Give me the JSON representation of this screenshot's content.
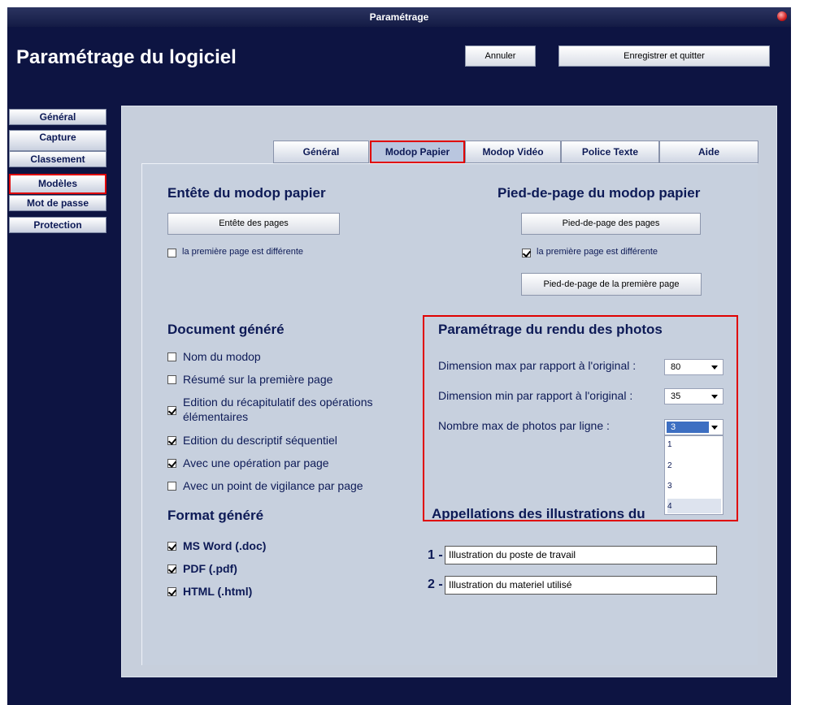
{
  "window": {
    "title": "Paramétrage"
  },
  "header": {
    "title": "Paramétrage du logiciel",
    "cancel_label": "Annuler",
    "save_label": "Enregistrer et quitter"
  },
  "sidebar": {
    "items": [
      {
        "label": "Général"
      },
      {
        "label": "Capture"
      },
      {
        "label": "Classement"
      },
      {
        "label": "Modèles"
      },
      {
        "label": "Mot de passe"
      },
      {
        "label": "Protection"
      }
    ],
    "selected": "Modèles"
  },
  "tabs": [
    {
      "label": "Général"
    },
    {
      "label": "Modop Papier"
    },
    {
      "label": "Modop Vidéo"
    },
    {
      "label": "Police Texte"
    },
    {
      "label": "Aide"
    }
  ],
  "selected_tab": "Modop Papier",
  "entete": {
    "heading": "Entête du modop papier",
    "button": "Entête des pages",
    "checkbox_label": "la première page est différente",
    "checkbox_checked": false
  },
  "pied": {
    "heading": "Pied-de-page du modop papier",
    "button": "Pied-de-page des pages",
    "checkbox_label": "la première page est différente",
    "checkbox_checked": true,
    "first_page_button": "Pied-de-page de la première page"
  },
  "document": {
    "heading": "Document généré",
    "options": [
      {
        "label": "Nom du modop",
        "checked": false
      },
      {
        "label": "Résumé sur la première page",
        "checked": false
      },
      {
        "label_line1": "Edition du récapitulatif des opérations",
        "label_line2": "élémentaires",
        "checked": true
      },
      {
        "label": "Edition du descriptif séquentiel",
        "checked": true
      },
      {
        "label": "Avec une opération par page",
        "checked": true
      },
      {
        "label": "Avec un point de vigilance par page",
        "checked": false
      }
    ]
  },
  "format": {
    "heading": "Format généré",
    "options": [
      {
        "label": "MS Word (.doc)",
        "checked": true
      },
      {
        "label": "PDF (.pdf)",
        "checked": true
      },
      {
        "label": "HTML (.html)",
        "checked": true
      }
    ]
  },
  "photos": {
    "heading": "Paramétrage du rendu des photos",
    "max_label": "Dimension max par rapport à l'original :",
    "max_value": "80",
    "min_label": "Dimension min par rapport à l'original :",
    "min_value": "35",
    "count_label": "Nombre max de photos par ligne :",
    "count_value": "3",
    "count_options": [
      "1",
      "2",
      "3",
      "4"
    ]
  },
  "illustrations": {
    "heading": "Appellations des illustrations du",
    "items": [
      {
        "number": "1 -",
        "value": "Illustration du poste de travail"
      },
      {
        "number": "2 -",
        "value": "Illustration du materiel utilisé"
      }
    ]
  },
  "colors": {
    "background": "#0d1442",
    "panel": "#c7cfdc",
    "text": "#0d1a56",
    "highlight": "#e00000"
  }
}
